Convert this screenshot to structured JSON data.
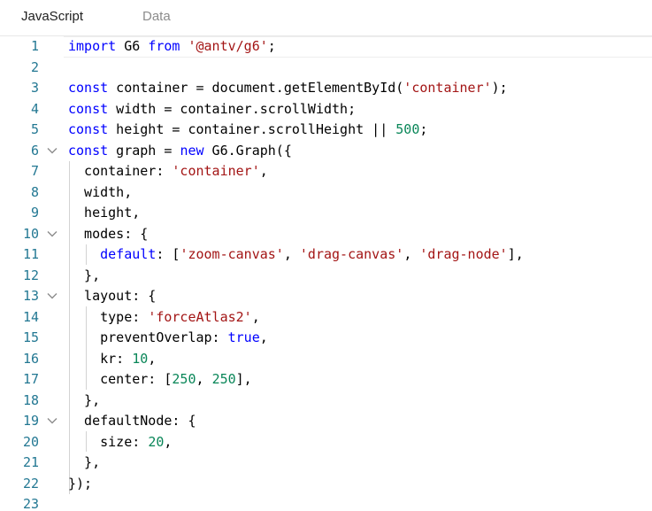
{
  "tabs": [
    {
      "label": "JavaScript",
      "active": true
    },
    {
      "label": "Data",
      "active": false
    }
  ],
  "editor": {
    "lines": [
      {
        "n": "1",
        "fold": false,
        "tokens": [
          [
            "kw",
            "import"
          ],
          [
            "t",
            " G6 "
          ],
          [
            "kw",
            "from"
          ],
          [
            "t",
            " "
          ],
          [
            "str",
            "'@antv/g6'"
          ],
          [
            "t",
            ";"
          ]
        ]
      },
      {
        "n": "2",
        "fold": false,
        "tokens": []
      },
      {
        "n": "3",
        "fold": false,
        "tokens": [
          [
            "kw",
            "const"
          ],
          [
            "t",
            " container = document.getElementById("
          ],
          [
            "str",
            "'container'"
          ],
          [
            "t",
            ");"
          ]
        ]
      },
      {
        "n": "4",
        "fold": false,
        "tokens": [
          [
            "kw",
            "const"
          ],
          [
            "t",
            " width = container.scrollWidth;"
          ]
        ]
      },
      {
        "n": "5",
        "fold": false,
        "tokens": [
          [
            "kw",
            "const"
          ],
          [
            "t",
            " height = container.scrollHeight || "
          ],
          [
            "num",
            "500"
          ],
          [
            "t",
            ";"
          ]
        ]
      },
      {
        "n": "6",
        "fold": true,
        "tokens": [
          [
            "kw",
            "const"
          ],
          [
            "t",
            " graph = "
          ],
          [
            "kw",
            "new"
          ],
          [
            "t",
            " G6.Graph({"
          ]
        ]
      },
      {
        "n": "7",
        "fold": false,
        "tokens": [
          [
            "t",
            "  container: "
          ],
          [
            "str",
            "'container'"
          ],
          [
            "t",
            ","
          ]
        ]
      },
      {
        "n": "8",
        "fold": false,
        "tokens": [
          [
            "t",
            "  width,"
          ]
        ]
      },
      {
        "n": "9",
        "fold": false,
        "tokens": [
          [
            "t",
            "  height,"
          ]
        ]
      },
      {
        "n": "10",
        "fold": true,
        "tokens": [
          [
            "t",
            "  modes: {"
          ]
        ]
      },
      {
        "n": "11",
        "fold": false,
        "tokens": [
          [
            "t",
            "    "
          ],
          [
            "kw",
            "default"
          ],
          [
            "t",
            ": ["
          ],
          [
            "str",
            "'zoom-canvas'"
          ],
          [
            "t",
            ", "
          ],
          [
            "str",
            "'drag-canvas'"
          ],
          [
            "t",
            ", "
          ],
          [
            "str",
            "'drag-node'"
          ],
          [
            "t",
            "],"
          ]
        ]
      },
      {
        "n": "12",
        "fold": false,
        "tokens": [
          [
            "t",
            "  },"
          ]
        ]
      },
      {
        "n": "13",
        "fold": true,
        "tokens": [
          [
            "t",
            "  layout: {"
          ]
        ]
      },
      {
        "n": "14",
        "fold": false,
        "tokens": [
          [
            "t",
            "    type: "
          ],
          [
            "str",
            "'forceAtlas2'"
          ],
          [
            "t",
            ","
          ]
        ]
      },
      {
        "n": "15",
        "fold": false,
        "tokens": [
          [
            "t",
            "    preventOverlap: "
          ],
          [
            "kw",
            "true"
          ],
          [
            "t",
            ","
          ]
        ]
      },
      {
        "n": "16",
        "fold": false,
        "tokens": [
          [
            "t",
            "    kr: "
          ],
          [
            "num",
            "10"
          ],
          [
            "t",
            ","
          ]
        ]
      },
      {
        "n": "17",
        "fold": false,
        "tokens": [
          [
            "t",
            "    center: ["
          ],
          [
            "num",
            "250"
          ],
          [
            "t",
            ", "
          ],
          [
            "num",
            "250"
          ],
          [
            "t",
            "],"
          ]
        ]
      },
      {
        "n": "18",
        "fold": false,
        "tokens": [
          [
            "t",
            "  },"
          ]
        ]
      },
      {
        "n": "19",
        "fold": true,
        "tokens": [
          [
            "t",
            "  defaultNode: {"
          ]
        ]
      },
      {
        "n": "20",
        "fold": false,
        "tokens": [
          [
            "t",
            "    size: "
          ],
          [
            "num",
            "20"
          ],
          [
            "t",
            ","
          ]
        ]
      },
      {
        "n": "21",
        "fold": false,
        "tokens": [
          [
            "t",
            "  },"
          ]
        ]
      },
      {
        "n": "22",
        "fold": false,
        "tokens": [
          [
            "t",
            "});"
          ]
        ]
      },
      {
        "n": "23",
        "fold": false,
        "tokens": []
      }
    ]
  },
  "colors": {
    "keyword": "#0000ff",
    "string": "#a31515",
    "number": "#098658",
    "line_number": "#237893"
  }
}
